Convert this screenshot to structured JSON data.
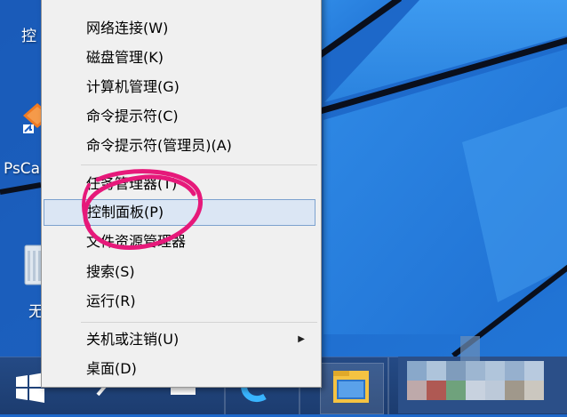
{
  "desktop": {
    "icons": [
      {
        "label": "控"
      },
      {
        "label": "PsCa"
      },
      {
        "label": "无"
      }
    ]
  },
  "context_menu": {
    "items": [
      {
        "label": "网络连接(W)"
      },
      {
        "label": "磁盘管理(K)"
      },
      {
        "label": "计算机管理(G)"
      },
      {
        "label": "命令提示符(C)"
      },
      {
        "label": "命令提示符(管理员)(A)"
      },
      {
        "label": "任务管理器(T)"
      },
      {
        "label": "控制面板(P)",
        "highlighted": true
      },
      {
        "label": "文件资源管理器"
      },
      {
        "label": "搜索(S)"
      },
      {
        "label": "运行(R)"
      },
      {
        "label": "关机或注销(U)",
        "has_submenu": true
      },
      {
        "label": "桌面(D)"
      }
    ],
    "submenu_arrow_icon": "chevron-right-icon",
    "highlight_color": "#dbe6f4",
    "highlight_border_color": "#7da2ce"
  },
  "annotation": {
    "shape": "hand-drawn-circle",
    "color": "#e6197a"
  },
  "taskbar": {
    "items": [
      {
        "icon": "windows-start-icon"
      },
      {
        "icon": "search-icon"
      },
      {
        "icon": "task-view-icon"
      },
      {
        "icon": "internet-explorer-icon"
      },
      {
        "icon": "file-explorer-icon"
      }
    ],
    "tray": "blurred-system-tray"
  },
  "colors": {
    "desktop_blue": "#1d67c9",
    "taskbar": "#244a85",
    "menu_background": "#f0f0f0"
  }
}
